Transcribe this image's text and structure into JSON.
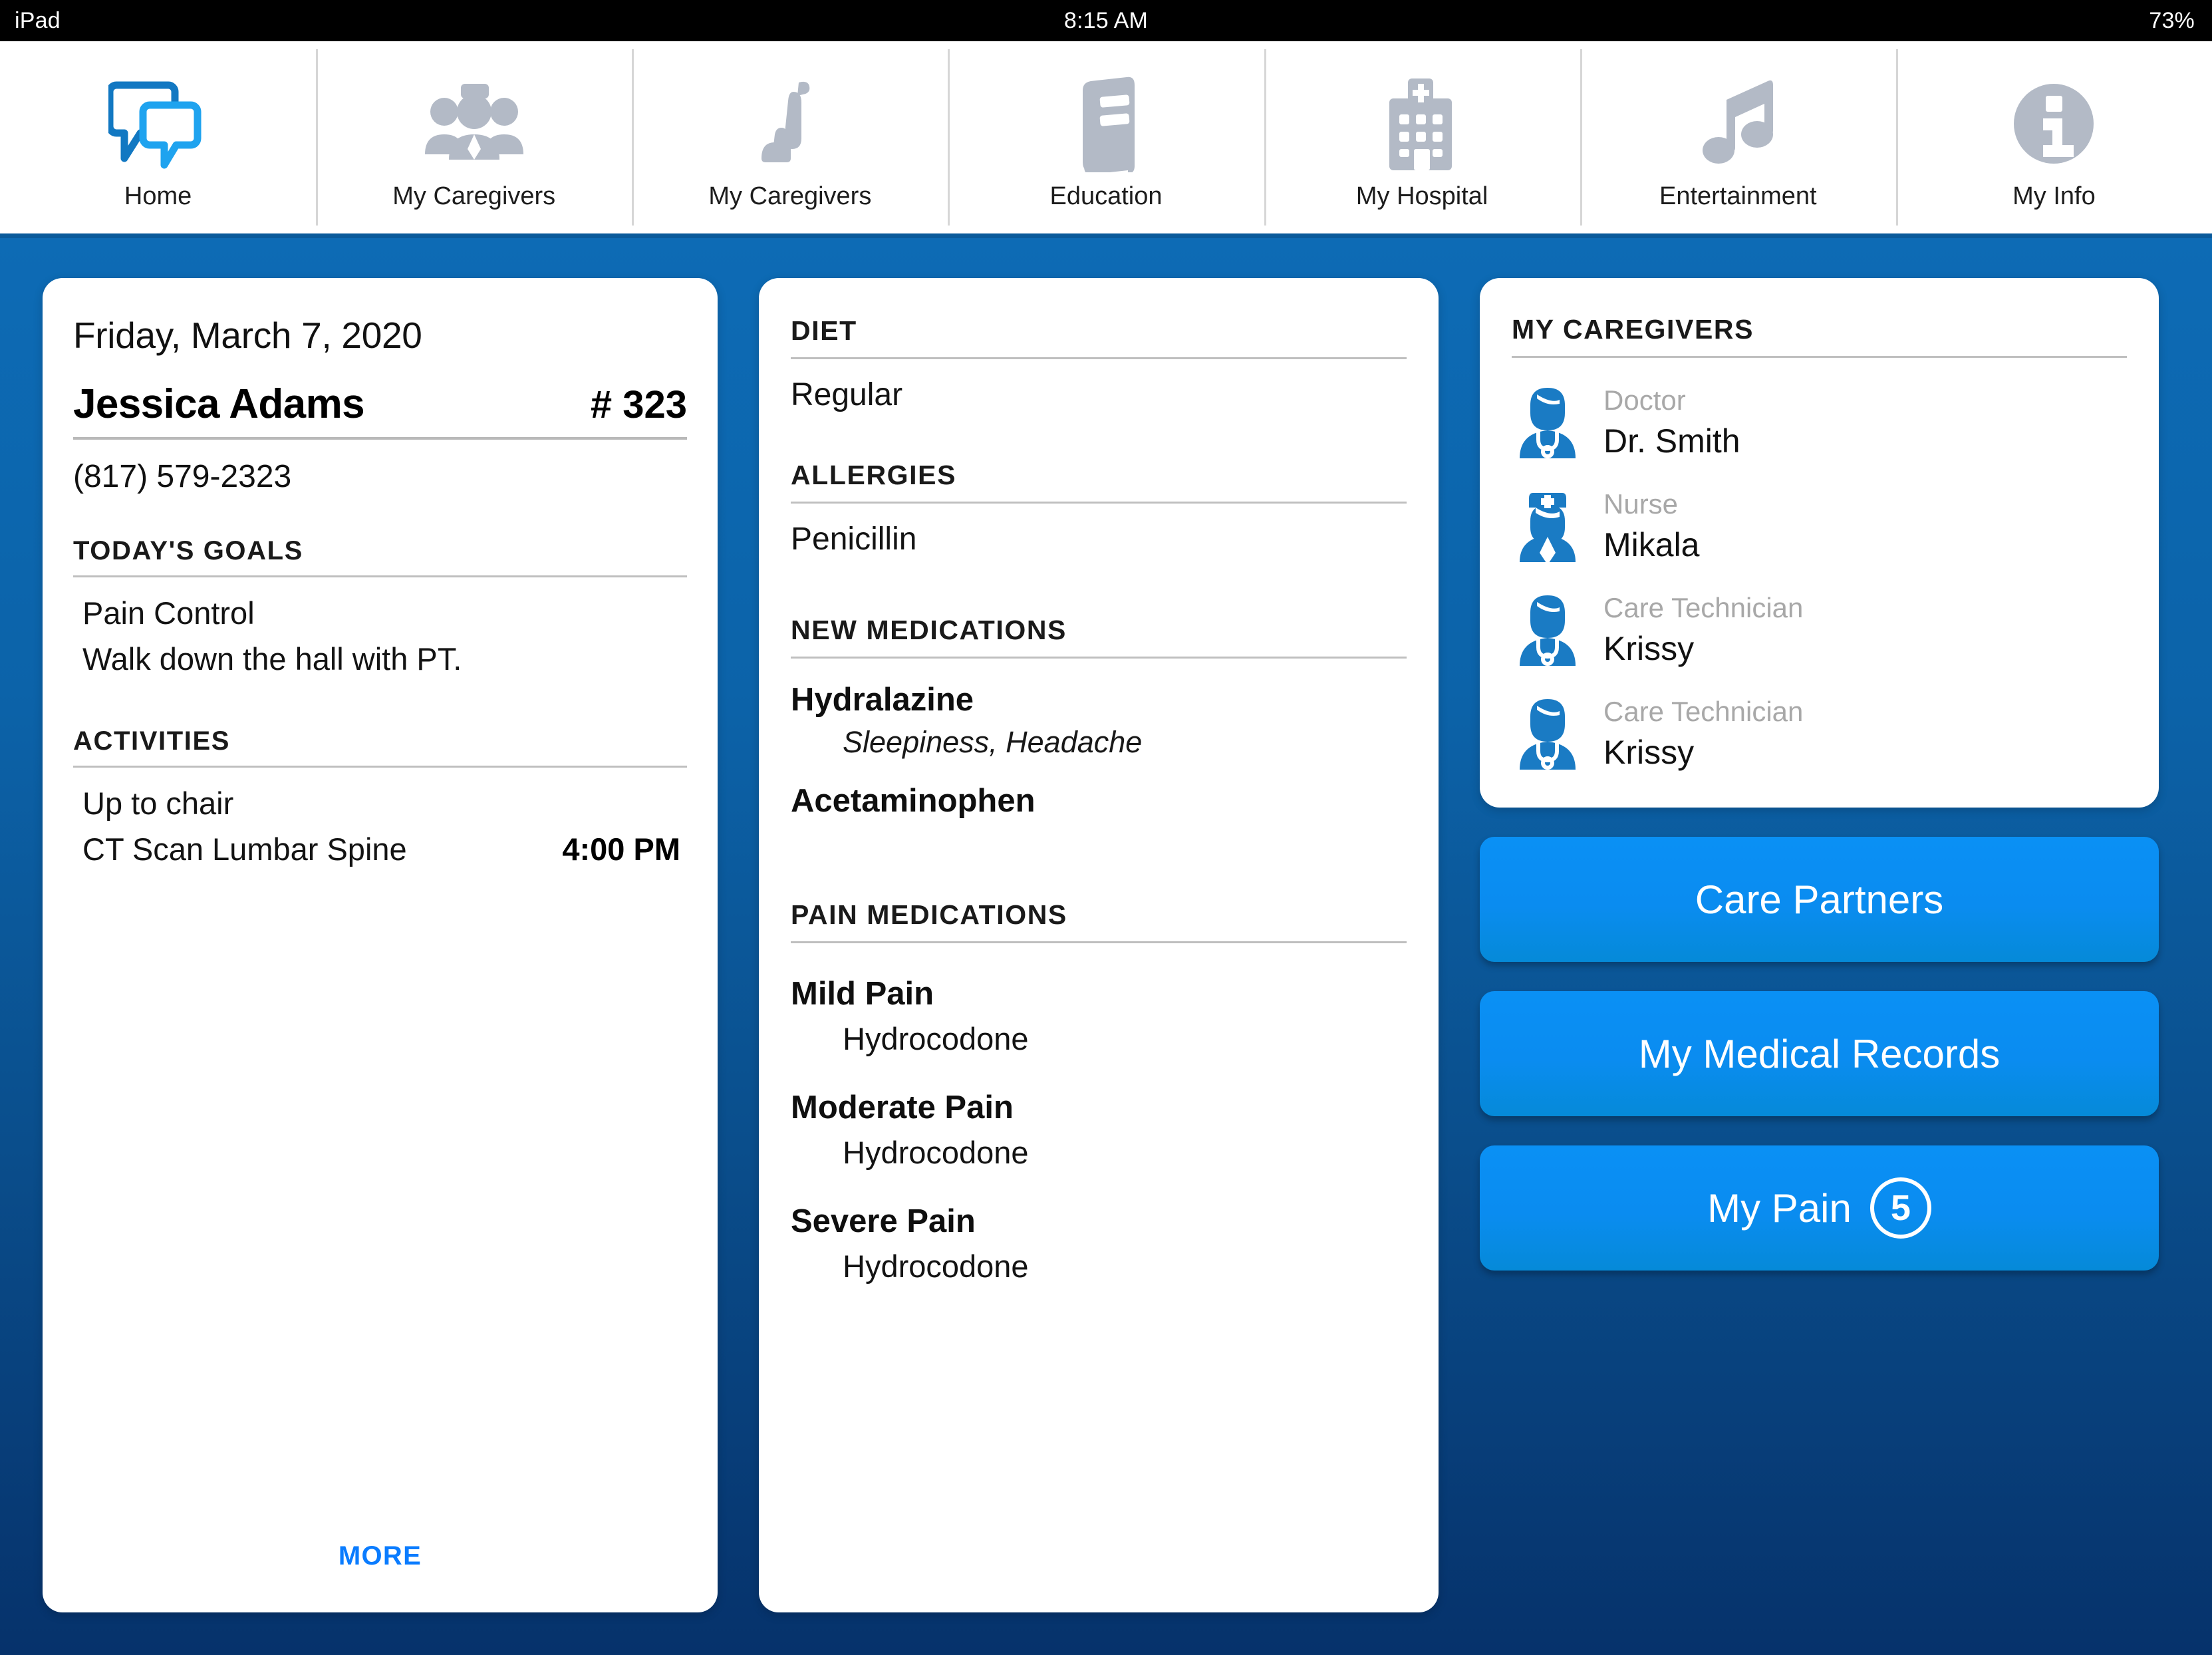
{
  "statusbar": {
    "device": "iPad",
    "time": "8:15 AM",
    "battery": "73%"
  },
  "nav": {
    "tabs": [
      {
        "label": "Home",
        "icon": "chat-bubbles-icon",
        "active": true
      },
      {
        "label": "My Caregivers",
        "icon": "care-team-icon",
        "active": false
      },
      {
        "label": "My Caregivers",
        "icon": "recliner-chair-icon",
        "active": false
      },
      {
        "label": "Education",
        "icon": "book-icon",
        "active": false
      },
      {
        "label": "My Hospital",
        "icon": "hospital-icon",
        "active": false
      },
      {
        "label": "Entertainment",
        "icon": "music-note-icon",
        "active": false
      },
      {
        "label": "My Info",
        "icon": "info-circle-icon",
        "active": false
      }
    ]
  },
  "patient_card": {
    "date": "Friday, March 7, 2020",
    "name": "Jessica Adams",
    "room": "# 323",
    "phone": "(817) 579-2323",
    "goals_heading": "TODAY'S GOALS",
    "goals": [
      "Pain Control",
      "Walk down the hall with PT."
    ],
    "activities_heading": "ACTIVITIES",
    "activities": [
      {
        "name": "Up to chair",
        "time": ""
      },
      {
        "name": "CT Scan Lumbar Spine",
        "time": "4:00 PM"
      }
    ],
    "more_label": "MORE"
  },
  "clinical_card": {
    "diet_heading": "DIET",
    "diet_value": "Regular",
    "allergies_heading": "ALLERGIES",
    "allergies_value": "Penicillin",
    "new_meds_heading": "NEW MEDICATIONS",
    "new_meds": [
      {
        "name": "Hydralazine",
        "side_effects": "Sleepiness, Headache"
      },
      {
        "name": "Acetaminophen",
        "side_effects": ""
      }
    ],
    "pain_meds_heading": "PAIN MEDICATIONS",
    "pain_meds": [
      {
        "level": "Mild Pain",
        "drug": "Hydrocodone"
      },
      {
        "level": "Moderate Pain",
        "drug": "Hydrocodone"
      },
      {
        "level": "Severe Pain",
        "drug": "Hydrocodone"
      }
    ]
  },
  "caregivers_card": {
    "heading": "MY CAREGIVERS",
    "people": [
      {
        "role": "Doctor",
        "name": "Dr. Smith",
        "icon": "doctor-avatar-icon"
      },
      {
        "role": "Nurse",
        "name": "Mikala",
        "icon": "nurse-avatar-icon"
      },
      {
        "role": "Care Technician",
        "name": "Krissy",
        "icon": "tech-avatar-icon"
      },
      {
        "role": "Care Technician",
        "name": "Krissy",
        "icon": "tech-avatar-icon"
      }
    ]
  },
  "actions": {
    "care_partners": "Care Partners",
    "medical_records": "My Medical Records",
    "my_pain": "My Pain",
    "my_pain_score": "5"
  },
  "colors": {
    "background_top": "#0d6bb5",
    "background_bottom": "#06326b",
    "brand_blue": "#0a7cff",
    "button_blue": "#0a8cf0",
    "icon_gray": "#b3bac6",
    "accent_icon_blue": "#1a7bc4"
  }
}
